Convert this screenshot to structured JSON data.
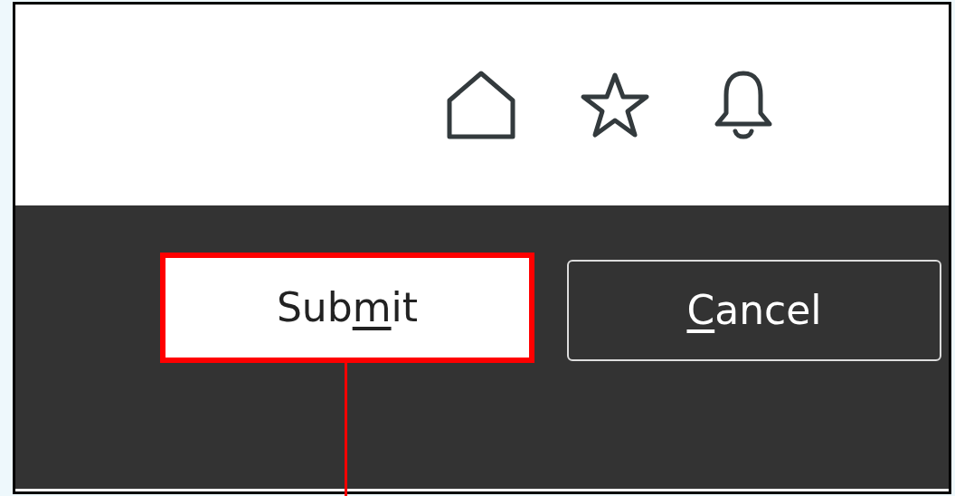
{
  "toolbar": {
    "icons": [
      {
        "kind": "home"
      },
      {
        "kind": "star"
      },
      {
        "kind": "bell"
      }
    ]
  },
  "buttons": [
    {
      "text_before": "Sub",
      "mnemonic": "m",
      "text_after": "it",
      "highlighted": true,
      "kind": "primary"
    },
    {
      "mnemonic": "C",
      "text_after": "ancel",
      "highlighted": false,
      "kind": "secondary"
    }
  ]
}
